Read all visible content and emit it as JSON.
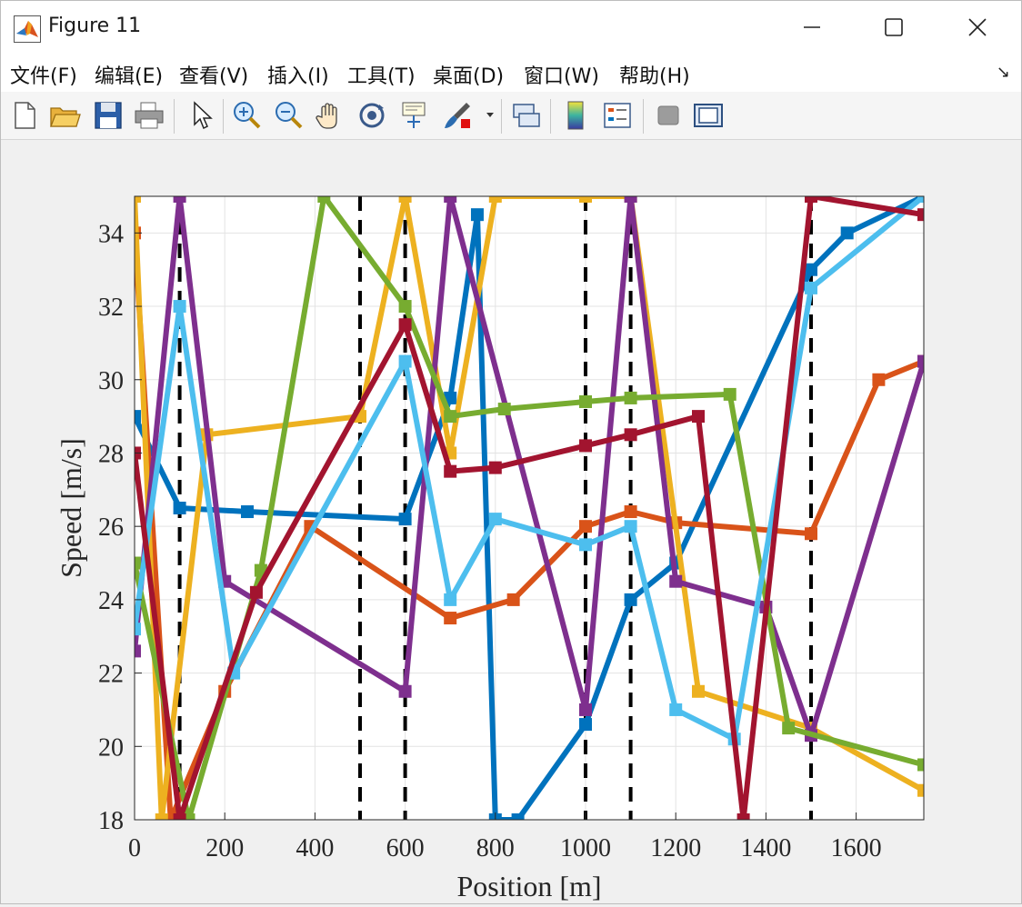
{
  "window": {
    "title": "Figure 11"
  },
  "menu": {
    "items": [
      "文件(F)",
      "编辑(E)",
      "查看(V)",
      "插入(I)",
      "工具(T)",
      "桌面(D)",
      "窗口(W)",
      "帮助(H)"
    ]
  },
  "toolbar": {
    "icons": [
      "new-figure-icon",
      "open-file-icon",
      "save-icon",
      "print-icon",
      "pointer-icon",
      "zoom-in-icon",
      "zoom-out-icon",
      "pan-hand-icon",
      "rotate-3d-icon",
      "data-cursor-icon",
      "brush-icon",
      "link-plot-icon",
      "colorbar-icon",
      "legend-icon",
      "hide-plot-tools-icon",
      "show-plot-tools-icon"
    ]
  },
  "colors": {
    "blue": "#0072BD",
    "orange": "#D95319",
    "yellow": "#EDB120",
    "purple": "#7E2F8E",
    "green": "#77AC30",
    "cyan": "#4DBEEE",
    "red": "#A2142F"
  },
  "chart_data": {
    "type": "line",
    "xlabel": "Position [m]",
    "ylabel": "Speed [m/s]",
    "xlim": [
      0,
      1750
    ],
    "ylim": [
      18,
      35
    ],
    "xticks": [
      "0",
      "200",
      "400",
      "600",
      "800",
      "1000",
      "1200",
      "1400",
      "1600"
    ],
    "yticks": [
      "18",
      "20",
      "22",
      "24",
      "26",
      "28",
      "30",
      "32",
      "34"
    ],
    "grid": true,
    "legend": "none",
    "vertical_dashed_lines_x": [
      100,
      500,
      600,
      1000,
      1100,
      1500
    ],
    "series": [
      {
        "color": "blue",
        "x": [
          0,
          100,
          250,
          600,
          700,
          760,
          800,
          850,
          1000,
          1100,
          1200,
          1500,
          1580,
          1750
        ],
        "y": [
          29,
          26.5,
          26.4,
          26.2,
          29.5,
          34.5,
          18,
          18,
          20.6,
          24,
          25,
          33,
          34,
          35
        ]
      },
      {
        "color": "orange",
        "x": [
          0,
          80,
          200,
          390,
          700,
          840,
          1000,
          1100,
          1200,
          1500,
          1650,
          1750
        ],
        "y": [
          34,
          18,
          21.5,
          26,
          23.5,
          24,
          26,
          26.4,
          26.1,
          25.8,
          30,
          30.5
        ]
      },
      {
        "color": "yellow",
        "x": [
          0,
          60,
          160,
          500,
          600,
          700,
          800,
          1000,
          1100,
          1250,
          1500,
          1750
        ],
        "y": [
          35,
          18,
          28.5,
          29,
          35,
          28,
          35,
          35,
          35,
          21.5,
          20.5,
          18.8
        ]
      },
      {
        "color": "purple",
        "x": [
          0,
          100,
          200,
          600,
          700,
          1000,
          1100,
          1200,
          1400,
          1500,
          1750
        ],
        "y": [
          22.6,
          35,
          24.5,
          21.5,
          35,
          21,
          35,
          24.5,
          23.8,
          20.3,
          30.5
        ]
      },
      {
        "color": "green",
        "x": [
          0,
          120,
          280,
          420,
          600,
          700,
          820,
          1000,
          1100,
          1320,
          1450,
          1750
        ],
        "y": [
          25,
          18,
          24.8,
          35,
          32,
          29,
          29.2,
          29.4,
          29.5,
          29.6,
          20.5,
          19.5
        ]
      },
      {
        "color": "cyan",
        "x": [
          0,
          100,
          220,
          600,
          700,
          800,
          1000,
          1100,
          1200,
          1330,
          1500,
          1750
        ],
        "y": [
          23.2,
          32,
          22,
          30.5,
          24,
          26.2,
          25.5,
          26,
          21,
          20.2,
          32.5,
          35
        ]
      },
      {
        "color": "red",
        "x": [
          0,
          100,
          270,
          600,
          700,
          800,
          1000,
          1100,
          1250,
          1350,
          1500,
          1750
        ],
        "y": [
          28,
          18,
          24.2,
          31.5,
          27.5,
          27.6,
          28.2,
          28.5,
          29,
          18,
          35,
          34.5
        ]
      }
    ]
  }
}
